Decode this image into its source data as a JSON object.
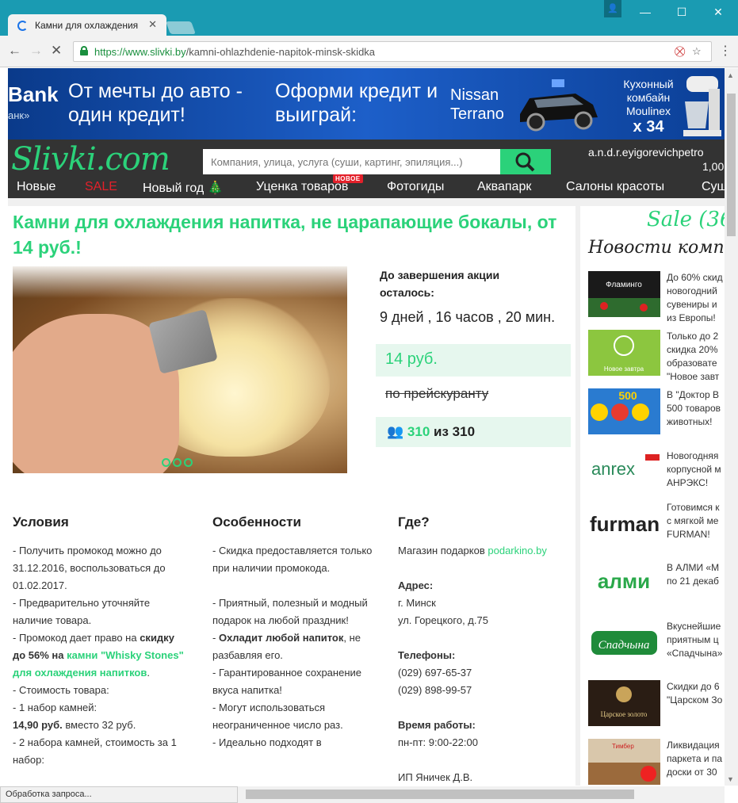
{
  "browser": {
    "tab_title": "Камни для охлаждения",
    "url_scheme": "https://www.slivki.by",
    "url_path": "/kamni-ohlazhdenie-napitok-minsk-skidka",
    "status_text": "Обработка запроса..."
  },
  "banner": {
    "bank": "Bank",
    "bank_sub": "анк»",
    "text1": "От мечты до авто - один кредит!",
    "text2": "Оформи кредит и выиграй:",
    "car": "Nissan Terrano",
    "kitchen": "Кухонный комбайн Moulinex",
    "kitchen_count": "x 34"
  },
  "header": {
    "logo": "Slivki.com",
    "search_placeholder": "Компания, улица, услуга (суши, картинг, эпиляция...)",
    "user": "a.n.d.r.eyigorevichpetro",
    "balance": "1,00"
  },
  "nav": {
    "items": [
      "Новые",
      "SALE",
      "Новый год 🎄",
      "Уценка товаров",
      "Фотогиды",
      "Аквапарк",
      "Салоны красоты",
      "Суш"
    ],
    "badge": "НОВОЕ"
  },
  "offer": {
    "title": "Камни для охлаждения напитка, не царапающие бокалы, от 14 руб.!",
    "countdown_label": "До завершения акции осталось:",
    "countdown": "9 дней , 16 часов , 20 мин.",
    "price": "14 руб.",
    "old_price": "по прейскуранту",
    "count_used": "310",
    "count_sep": "из",
    "count_total": "310"
  },
  "conditions": {
    "title": "Условия",
    "l1": "- Получить промокод можно до 31.12.2016, воспользоваться до 01.02.2017.",
    "l2": "- Предварительно уточняйте наличие товара.",
    "l3a": "- Промокод дает право на ",
    "l3b": "скидку до 56% на ",
    "l3c": "камни \"Whisky Stones\" для охлаждения напитков",
    "l4": "- Стоимость товара:",
    "l5": "- 1 набор камней:",
    "l6a": "14,90 руб.",
    "l6b": " вместо 32 руб.",
    "l7": "- 2 набора камней, стоимость за 1 набор:"
  },
  "features": {
    "title": "Особенности",
    "l1": "- Скидка предоставляется только при наличии промокода.",
    "l2": "- Приятный, полезный и модный подарок на любой праздник!",
    "l3a": "- ",
    "l3b": "Охладит любой напиток",
    "l3c": ", не разбавляя его.",
    "l4": "- Гарантированное сохранение вкуса напитка!",
    "l5": "- Могут использоваться неограниченное число раз.",
    "l6": "- Идеально подходят в"
  },
  "where": {
    "title": "Где?",
    "shop_label": "Магазин подарков ",
    "shop_link": "podarkino.by",
    "addr_label": "Адрес:",
    "addr1": "г. Минск",
    "addr2": "ул. Горецкого, д.75",
    "phone_label": "Телефоны:",
    "phone1": "(029) 697-65-37",
    "phone2": "(029) 898-99-57",
    "hours_label": "Время работы:",
    "hours": "пн-пт: 9:00-22:00",
    "owner": "ИП Яничек Д.В."
  },
  "sidebar": {
    "sale": "Sale (36",
    "news_title": "Новости компан",
    "news": [
      {
        "thumb": "Фламинго",
        "l1": "До 60% скид",
        "l2": "новогодний",
        "l3": "сувениры и",
        "l4": "из Европы!"
      },
      {
        "thumb": "Новое завтра",
        "l1": "Только до 2",
        "l2": "скидка 20%",
        "l3": "образовате",
        "l4": "\"Новое завт"
      },
      {
        "thumb": "500",
        "l1": "В \"Доктор В",
        "l2": "500 товаров",
        "l3": "животных!",
        "l4": ""
      },
      {
        "thumb": "anrex",
        "l1": "Новогодняя",
        "l2": "корпусной м",
        "l3": "АНРЭКС!",
        "l4": ""
      },
      {
        "thumb": "furman",
        "l1": "Готовимся к",
        "l2": "с мягкой ме",
        "l3": "FURMAN!",
        "l4": ""
      },
      {
        "thumb": "алми",
        "l1": "В АЛМИ «М",
        "l2": "по 21 декаб",
        "l3": "",
        "l4": ""
      },
      {
        "thumb": "Спадчына",
        "l1": "Вкуснейшие",
        "l2": "приятным ц",
        "l3": "«Спадчына»",
        "l4": ""
      },
      {
        "thumb": "Царское золото",
        "l1": "Скидки до 6",
        "l2": "\"Царском Зо",
        "l3": "",
        "l4": ""
      },
      {
        "thumb": "Тимбер",
        "l1": "Ликвидация",
        "l2": "паркета и па",
        "l3": "доски от 30",
        "l4": ""
      }
    ]
  },
  "colors": {
    "accent": "#2bd27a",
    "chrome": "#1a9bb2",
    "dark": "#333333",
    "sale": "#e3202a"
  }
}
